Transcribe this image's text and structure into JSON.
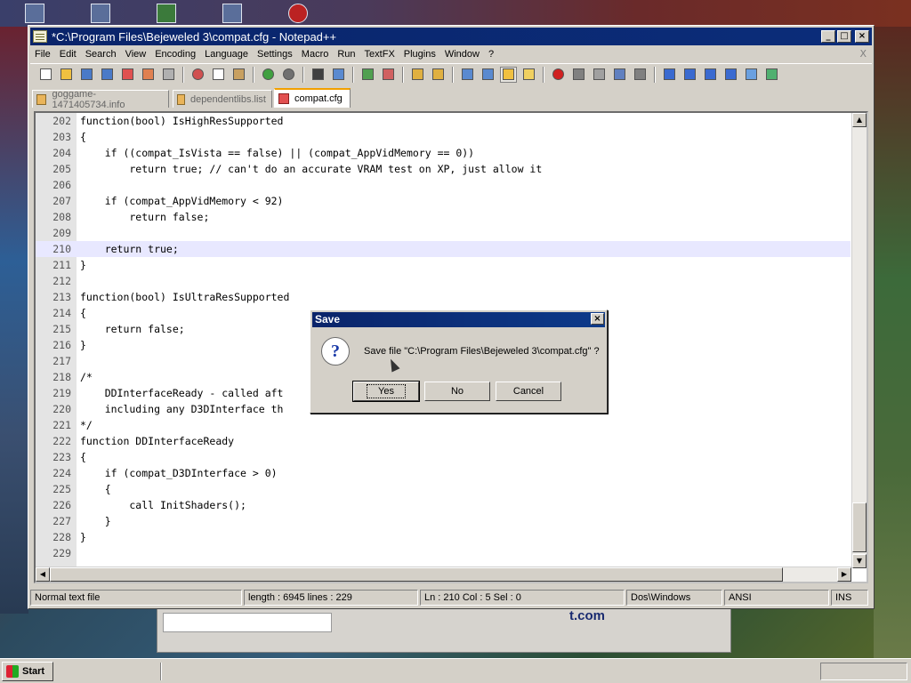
{
  "window": {
    "title": "*C:\\Program Files\\Bejeweled 3\\compat.cfg - Notepad++",
    "minimize": "_",
    "maximize": "□",
    "close": "×"
  },
  "menu": {
    "items": [
      "File",
      "Edit",
      "Search",
      "View",
      "Encoding",
      "Language",
      "Settings",
      "Macro",
      "Run",
      "TextFX",
      "Plugins",
      "Window",
      "?"
    ],
    "close_x": "X"
  },
  "tabs": [
    {
      "label": "goggame-1471405734.info",
      "active": false
    },
    {
      "label": "dependentlibs.list",
      "active": false
    },
    {
      "label": "compat.cfg",
      "active": true
    }
  ],
  "editor": {
    "current_line": 210,
    "lines": [
      {
        "n": "202",
        "text": "function(bool) IsHighResSupported"
      },
      {
        "n": "203",
        "text": "{"
      },
      {
        "n": "204",
        "text": "    if ((compat_IsVista == false) || (compat_AppVidMemory == 0))"
      },
      {
        "n": "205",
        "text": "        return true; // can't do an accurate VRAM test on XP, just allow it"
      },
      {
        "n": "206",
        "text": ""
      },
      {
        "n": "207",
        "text": "    if (compat_AppVidMemory < 92)"
      },
      {
        "n": "208",
        "text": "        return false;"
      },
      {
        "n": "209",
        "text": ""
      },
      {
        "n": "210",
        "text": "    return true;"
      },
      {
        "n": "211",
        "text": "}"
      },
      {
        "n": "212",
        "text": ""
      },
      {
        "n": "213",
        "text": "function(bool) IsUltraResSupported"
      },
      {
        "n": "214",
        "text": "{"
      },
      {
        "n": "215",
        "text": "    return false;"
      },
      {
        "n": "216",
        "text": "}"
      },
      {
        "n": "217",
        "text": ""
      },
      {
        "n": "218",
        "text": "/*"
      },
      {
        "n": "219",
        "text": "    DDInterfaceReady - called aft"
      },
      {
        "n": "220",
        "text": "    including any D3DInterface th"
      },
      {
        "n": "221",
        "text": "*/"
      },
      {
        "n": "222",
        "text": "function DDInterfaceReady"
      },
      {
        "n": "223",
        "text": "{"
      },
      {
        "n": "224",
        "text": "    if (compat_D3DInterface > 0)"
      },
      {
        "n": "225",
        "text": "    {"
      },
      {
        "n": "226",
        "text": "        call InitShaders();"
      },
      {
        "n": "227",
        "text": "    }"
      },
      {
        "n": "228",
        "text": "}"
      },
      {
        "n": "229",
        "text": ""
      }
    ]
  },
  "status": {
    "type": "Normal text file",
    "length": "length : 6945    lines : 229",
    "position": "Ln : 210    Col : 5    Sel : 0",
    "eol": "Dos\\Windows",
    "encoding": "ANSI",
    "mode": "INS"
  },
  "dialog": {
    "title": "Save",
    "close": "×",
    "icon": "?",
    "message": "Save file \"C:\\Program Files\\Bejeweled 3\\compat.cfg\" ?",
    "yes": "Yes",
    "no": "No",
    "cancel": "Cancel"
  },
  "background_window": {
    "text": "t.com"
  },
  "taskbar": {
    "start": "Start"
  }
}
